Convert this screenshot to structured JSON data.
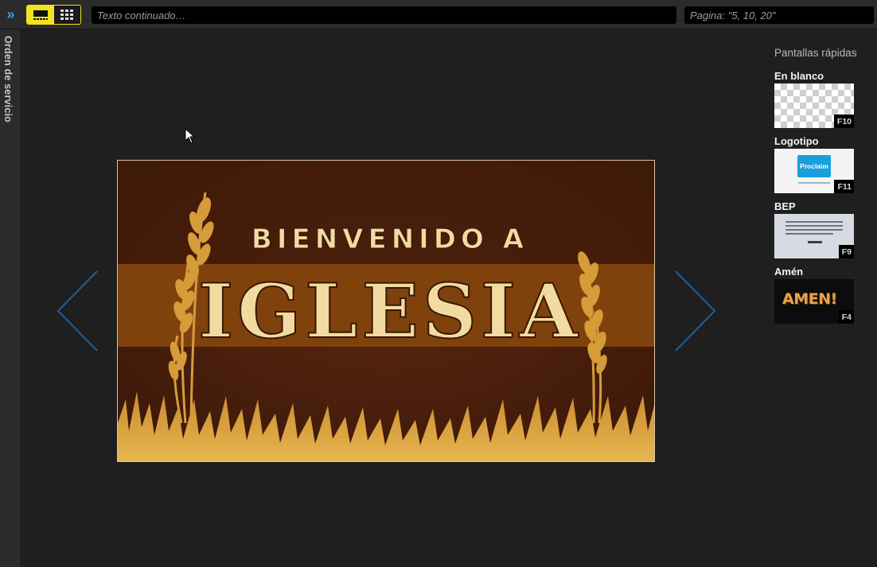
{
  "toolbar": {
    "expand_icon": "double-chevron-right-icon",
    "view_options": [
      "single-slide-icon",
      "grid-icon"
    ],
    "search_placeholder": "Texto continuado…",
    "page_placeholder": "Pagina: \"5, 10, 20\""
  },
  "sidebar": {
    "tab_label": "Orden de servicio"
  },
  "slide": {
    "line1": "BIENVENIDO A",
    "line2": "IGLESIA"
  },
  "quick_screens": {
    "title": "Pantallas rápidas",
    "items": [
      {
        "label": "En blanco",
        "key": "F10"
      },
      {
        "label": "Logotipo",
        "key": "F11",
        "logo_text": "Proclaim"
      },
      {
        "label": "BEP",
        "key": "F9"
      },
      {
        "label": "Amén",
        "key": "F4",
        "thumb_text": "AMEN!"
      }
    ]
  },
  "colors": {
    "accent_yellow": "#f4e21e",
    "accent_blue": "#3aa0e6",
    "arrow_blue": "#1f5f99",
    "slide_brown_dark": "#4a1e0c",
    "slide_band": "#7a3e0a",
    "slide_text": "#f2dba0"
  }
}
